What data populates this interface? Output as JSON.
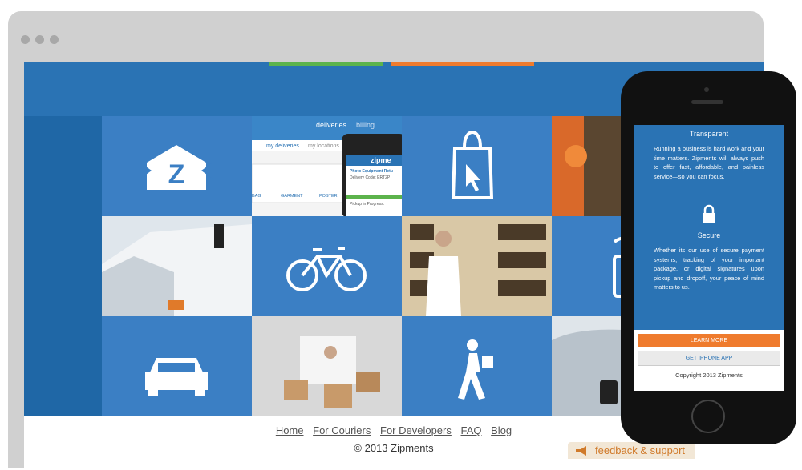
{
  "tiles": {
    "app_tabs": {
      "deliveries": "deliveries",
      "billing": "billing"
    },
    "app_subtabs": {
      "my_deliveries": "my deliveries",
      "my_locations": "my locations"
    },
    "app_items": [
      "BAG",
      "GARMENT",
      "POSTER"
    ],
    "phone_brand": "zipme",
    "phone_item": "Photo Equipment Retu",
    "delivery_code": "Delivery Code: ERT2P",
    "pickup_status": "Pickup in Progress."
  },
  "footer": {
    "links": [
      "Home",
      "For Couriers",
      "For Developers",
      "FAQ",
      "Blog"
    ],
    "copyright": "© 2013 Zipments"
  },
  "feedback": {
    "label": "feedback & support"
  },
  "phone": {
    "transparent_title": "Transparent",
    "transparent_text": "Running a business is hard work and your time matters. Zipments will always push to offer fast, affordable, and painless service—so you can focus.",
    "secure_title": "Secure",
    "secure_text": "Whether its our use of secure payment systems, tracking of your important package, or digital signatures upon pickup and dropoff, your peace of mind matters to us.",
    "learn_more": "LEARN MORE",
    "get_app": "GET IPHONE APP",
    "copyright": "Copyright 2013 Zipments"
  },
  "colors": {
    "brand_blue": "#3b7fc4",
    "header_blue": "#2a73b4",
    "accent_orange": "#ef7b2d",
    "accent_green": "#5cb34c"
  }
}
